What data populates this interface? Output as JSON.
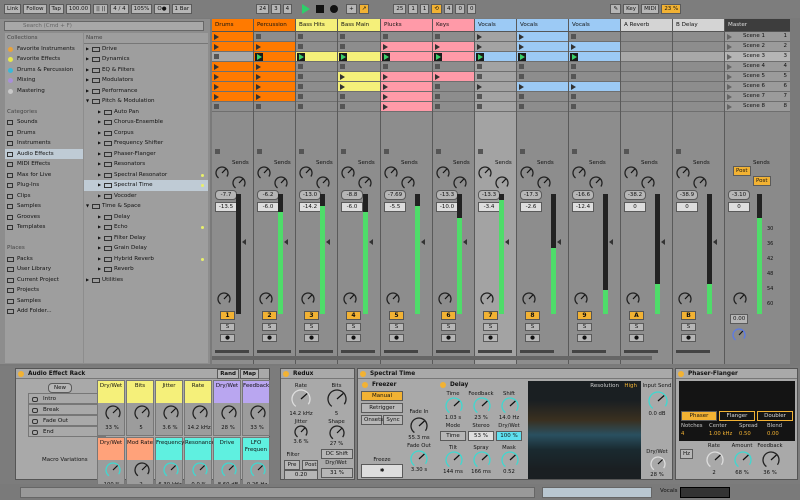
{
  "topbar": {
    "link": "Link",
    "follow": "Follow",
    "tap": "Tap",
    "tempo": "100.00",
    "signature": "4 / 4",
    "zoom": "105%",
    "metro": "O●",
    "quant": "1 Bar",
    "position": [
      "24",
      "3",
      "4"
    ],
    "loop_start": [
      "25",
      "1",
      "1"
    ],
    "loop_length": [
      "4",
      "0",
      "0"
    ],
    "key": "Key",
    "midi": "MIDI",
    "cpu": "23 %"
  },
  "browser": {
    "search_placeholder": "Search (Cmd + F)",
    "collections_header": "Collections",
    "collections": [
      {
        "label": "Favorite Instruments",
        "color": "#e8a33a"
      },
      {
        "label": "Favorite Effects",
        "color": "#e8e84a"
      },
      {
        "label": "Drums & Percussion",
        "color": "#3ab8d8"
      },
      {
        "label": "Mixing",
        "color": "#a88fd8"
      },
      {
        "label": "Mastering",
        "color": "#c8c8c8"
      }
    ],
    "categories_header": "Categories",
    "categories": [
      "Sounds",
      "Drums",
      "Instruments",
      "Audio Effects",
      "MIDI Effects",
      "Max for Live",
      "Plug-Ins",
      "Clips",
      "Samples",
      "Grooves",
      "Templates"
    ],
    "selected_category": "Audio Effects",
    "places_header": "Places",
    "places": [
      "Packs",
      "User Library",
      "Current Project",
      "Projects",
      "Samples",
      "Add Folder..."
    ],
    "name_header": "Name",
    "items": [
      {
        "label": "Drive",
        "depth": 0
      },
      {
        "label": "Dynamics",
        "depth": 0
      },
      {
        "label": "EQ & Filters",
        "depth": 0
      },
      {
        "label": "Modulators",
        "depth": 0
      },
      {
        "label": "Performance",
        "depth": 0
      },
      {
        "label": "Pitch & Modulation",
        "depth": 0,
        "open": true
      },
      {
        "label": "Auto Pan",
        "depth": 1
      },
      {
        "label": "Chorus-Ensemble",
        "depth": 1
      },
      {
        "label": "Corpus",
        "depth": 1
      },
      {
        "label": "Frequency Shifter",
        "depth": 1
      },
      {
        "label": "Phaser-Flanger",
        "depth": 1
      },
      {
        "label": "Resonators",
        "depth": 1
      },
      {
        "label": "Spectral Resonator",
        "depth": 1,
        "dot": true
      },
      {
        "label": "Spectral Time",
        "depth": 1,
        "dot": true,
        "selected": true
      },
      {
        "label": "Vocoder",
        "depth": 1
      },
      {
        "label": "Time & Space",
        "depth": 0,
        "open": true
      },
      {
        "label": "Delay",
        "depth": 1
      },
      {
        "label": "Echo",
        "depth": 1,
        "dot": true
      },
      {
        "label": "Filter Delay",
        "depth": 1
      },
      {
        "label": "Grain Delay",
        "depth": 1
      },
      {
        "label": "Hybrid Reverb",
        "depth": 1,
        "dot": true
      },
      {
        "label": "Reverb",
        "depth": 1
      },
      {
        "label": "Utilities",
        "depth": 0
      }
    ]
  },
  "tracks": [
    {
      "name": "Drums",
      "color": "#ff7a00",
      "clips": [
        "c",
        "c",
        "e",
        "c",
        "c",
        "c",
        "c",
        "e"
      ],
      "peak": "-7.7",
      "volume": "-13.5",
      "number": "1",
      "meter": 0
    },
    {
      "name": "Percussion",
      "color": "#ff7a00",
      "clips": [
        "e",
        "c",
        "p",
        "c",
        "c",
        "c",
        "c",
        "e"
      ],
      "peak": "-6.2",
      "volume": "-6.0",
      "number": "2",
      "meter": 0.85
    },
    {
      "name": "Bass Hits",
      "color": "#f5f07a",
      "clips": [
        "e",
        "e",
        "p",
        "e",
        "e",
        "e",
        "e",
        "e"
      ],
      "peak": "-13.0",
      "volume": "-14.2",
      "number": "3",
      "meter": 0.9
    },
    {
      "name": "Bass Main",
      "color": "#f5f07a",
      "clips": [
        "e",
        "e",
        "p",
        "e",
        "c",
        "c",
        "e",
        "e"
      ],
      "peak": "-8.8",
      "volume": "-6.0",
      "number": "4",
      "meter": 0.85
    },
    {
      "name": "Plucks",
      "color": "#ff9aa8",
      "clips": [
        "e",
        "c",
        "p",
        "e",
        "c",
        "c",
        "c",
        "c"
      ],
      "peak": "-7.69",
      "volume": "-5.5",
      "number": "5",
      "meter": 0.9
    },
    {
      "name": "Keys",
      "color": "#ff9aa8",
      "clips": [
        "e",
        "c",
        "p",
        "e",
        "c",
        "e",
        "e",
        "e"
      ],
      "peak": "-13.3",
      "volume": "-10.0",
      "number": "6",
      "meter": 0.8
    },
    {
      "name": "Vocals",
      "color": "#9ccaf5",
      "clips": [
        "s",
        "s",
        "p",
        "e",
        "e",
        "s",
        "e",
        "e"
      ],
      "peak": "-13.3",
      "volume": "-3.4",
      "number": "7",
      "meter": 0.95
    },
    {
      "name": "Vocals",
      "color": "#9ccaf5",
      "clips": [
        "c",
        "c",
        "p",
        "e",
        "e",
        "c",
        "e",
        "e"
      ],
      "peak": "-17.3",
      "volume": "-2.6",
      "number": "8",
      "meter": 0.55
    },
    {
      "name": "Vocals",
      "color": "#9ccaf5",
      "clips": [
        "e",
        "c",
        "p",
        "e",
        "e",
        "c",
        "e",
        "e"
      ],
      "peak": "-16.6",
      "volume": "-12.4",
      "number": "9",
      "meter": 0.2
    },
    {
      "name": "A Reverb",
      "color": "#d4d4d4",
      "clips": [],
      "peak": "-38.2",
      "volume": "0",
      "number": "A",
      "meter": 0.25
    },
    {
      "name": "B Delay",
      "color": "#d4d4d4",
      "clips": [],
      "peak": "-38.9",
      "volume": "0",
      "number": "B",
      "meter": 0.25
    }
  ],
  "master": {
    "name": "Master",
    "scenes": [
      "Scene 1",
      "Scene 2",
      "Scene 3",
      "Scene 4",
      "Scene 5",
      "Scene 6",
      "Scene 7",
      "Scene 8"
    ],
    "scene_numbers": [
      "1",
      "2",
      "3",
      "4",
      "5",
      "6",
      "7",
      "8"
    ],
    "peak": "-3.10",
    "volume": "0",
    "post": "Post",
    "meter": 0.8,
    "cue": "0.00"
  },
  "mixer": {
    "sends_label": "Sends",
    "solo": "S",
    "db_scale": [
      "30",
      "36",
      "42",
      "48",
      "54",
      "60"
    ]
  },
  "rack": {
    "title": "Audio Effect Rack",
    "rand": "Rand",
    "map": "Map",
    "new": "New",
    "variations": [
      "Intro",
      "Break",
      "Fade Out",
      "End"
    ],
    "variations_label": "Macro Variations",
    "macros": [
      {
        "label": "Dry/Wet",
        "value": "33 %",
        "color": "#f5f07a"
      },
      {
        "label": "Bits",
        "value": "5",
        "color": "#f5f07a"
      },
      {
        "label": "Jitter",
        "value": "3.6 %",
        "color": "#f5f07a"
      },
      {
        "label": "Rate",
        "value": "14.2 kHz",
        "color": "#f5f07a"
      },
      {
        "label": "Dry/Wet",
        "value": "28 %",
        "color": "#b9a6f0"
      },
      {
        "label": "Feedback",
        "value": "33 %",
        "color": "#b9a6f0"
      },
      {
        "label": "Dry/Wet",
        "value": "100 %",
        "color": "#ffa27a"
      },
      {
        "label": "Mod Rate",
        "value": "2",
        "color": "#ffa27a"
      },
      {
        "label": "Frequency",
        "value": "6.30 kHz",
        "color": "#5ff0e0"
      },
      {
        "label": "Resonance",
        "value": "0.0 %",
        "color": "#5ff0e0"
      },
      {
        "label": "Drive",
        "value": "8.60 dB",
        "color": "#5ff0e0"
      },
      {
        "label": "LFO Frequen",
        "value": "0.26 Hz",
        "color": "#5ff0e0"
      }
    ]
  },
  "redux": {
    "title": "Redux",
    "rate_label": "Rate",
    "rate": "14.2 kHz",
    "jitter_label": "Jitter",
    "jitter": "3.6 %",
    "bits_label": "Bits",
    "bits": "5",
    "shape_label": "Shape",
    "shape": "27 %",
    "dc_shift": "DC Shift",
    "filter_label": "Filter",
    "pre": "Pre",
    "post": "Post",
    "filter_value": "0.20",
    "drywet_label": "Dry/Wet",
    "drywet": "31 %"
  },
  "spectral": {
    "title": "Spectral Time",
    "freezer": "Freezer",
    "manual": "Manual",
    "retrigger": "Retrigger",
    "onsets": "Onsets",
    "sync": "Sync",
    "fade_in_label": "Fade In",
    "fade_in": "55.3 ms",
    "fade_out_label": "Fade Out",
    "fade_out": "3.30 s",
    "freeze": "Freeze",
    "delay": "Delay",
    "time_label": "Time",
    "time": "1.03 s",
    "feedback_label": "Feedback",
    "feedback": "23 %",
    "shift_label": "Shift",
    "shift": "14.0 Hz",
    "mode_label": "Mode",
    "mode": "Time",
    "stereo_label": "Stereo",
    "stereo": "53 %",
    "dw_label": "Dry/Wet",
    "dw": "100 %",
    "tilt_label": "Tilt",
    "tilt": "144 ms",
    "spray_label": "Spray",
    "spray": "166 ms",
    "mask_label": "Mask",
    "mask": "0.52",
    "resolution_label": "Resolution",
    "resolution": "High",
    "input_send_label": "Input Send",
    "input_send": "0.0 dB",
    "out_dw_label": "Dry/Wet",
    "out_dw": "28 %"
  },
  "phaser": {
    "title": "Phaser-Flanger",
    "modes": [
      "Phaser",
      "Flanger",
      "Doubler"
    ],
    "active_mode": "Phaser",
    "notches_label": "Notches",
    "notches": "4",
    "center_label": "Center",
    "center": "1.00 kHz",
    "spread_label": "Spread",
    "spread": "0.50",
    "blend_label": "Blend",
    "blend": "0.00",
    "hz": "Hz",
    "rate_label": "Rate",
    "rate": "2",
    "amount_label": "Amount",
    "amount": "68 %",
    "feedback_label": "Feedback",
    "feedback": "36 %"
  },
  "status": {
    "track": "Vocals"
  }
}
